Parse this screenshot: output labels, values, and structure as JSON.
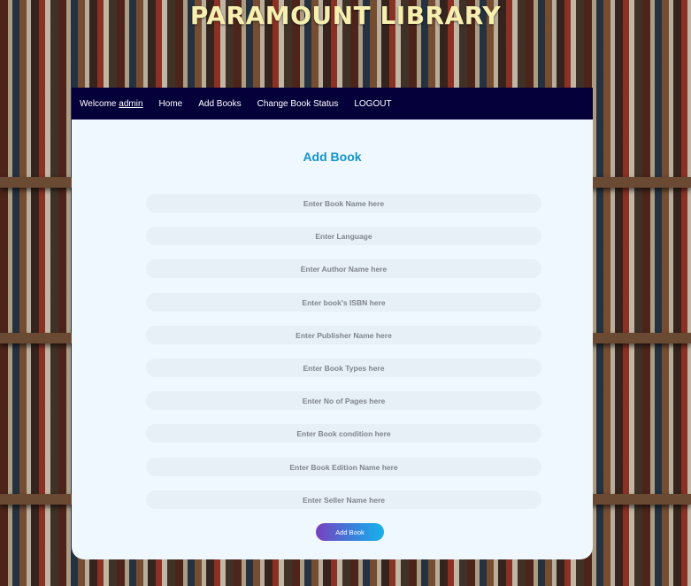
{
  "site": {
    "title": "PARAMOUNT LIBRARY"
  },
  "navbar": {
    "welcome_prefix": "Welcome",
    "username": "admin",
    "links": [
      "Home",
      "Add Books",
      "Change Book Status",
      "LOGOUT"
    ]
  },
  "form": {
    "heading": "Add Book",
    "fields": [
      {
        "placeholder": "Enter Book Name here"
      },
      {
        "placeholder": "Enter Language"
      },
      {
        "placeholder": "Enter Author Name here"
      },
      {
        "placeholder": "Enter book's ISBN here"
      },
      {
        "placeholder": "Enter Publisher Name here"
      },
      {
        "placeholder": "Enter Book Types here"
      },
      {
        "placeholder": "Enter No of Pages here"
      },
      {
        "placeholder": "Enter Book condition here"
      },
      {
        "placeholder": "Enter Book Edition Name here"
      },
      {
        "placeholder": "Enter Seller Name here"
      }
    ],
    "submit_label": "Add Book"
  },
  "colors": {
    "navbar_bg": "#06003a",
    "title_text": "#f6efb0",
    "heading": "#1592c8",
    "card_bg": "#f0f8ff",
    "button_gradient_start": "#7a3fc0",
    "button_gradient_end": "#19b2ea"
  }
}
